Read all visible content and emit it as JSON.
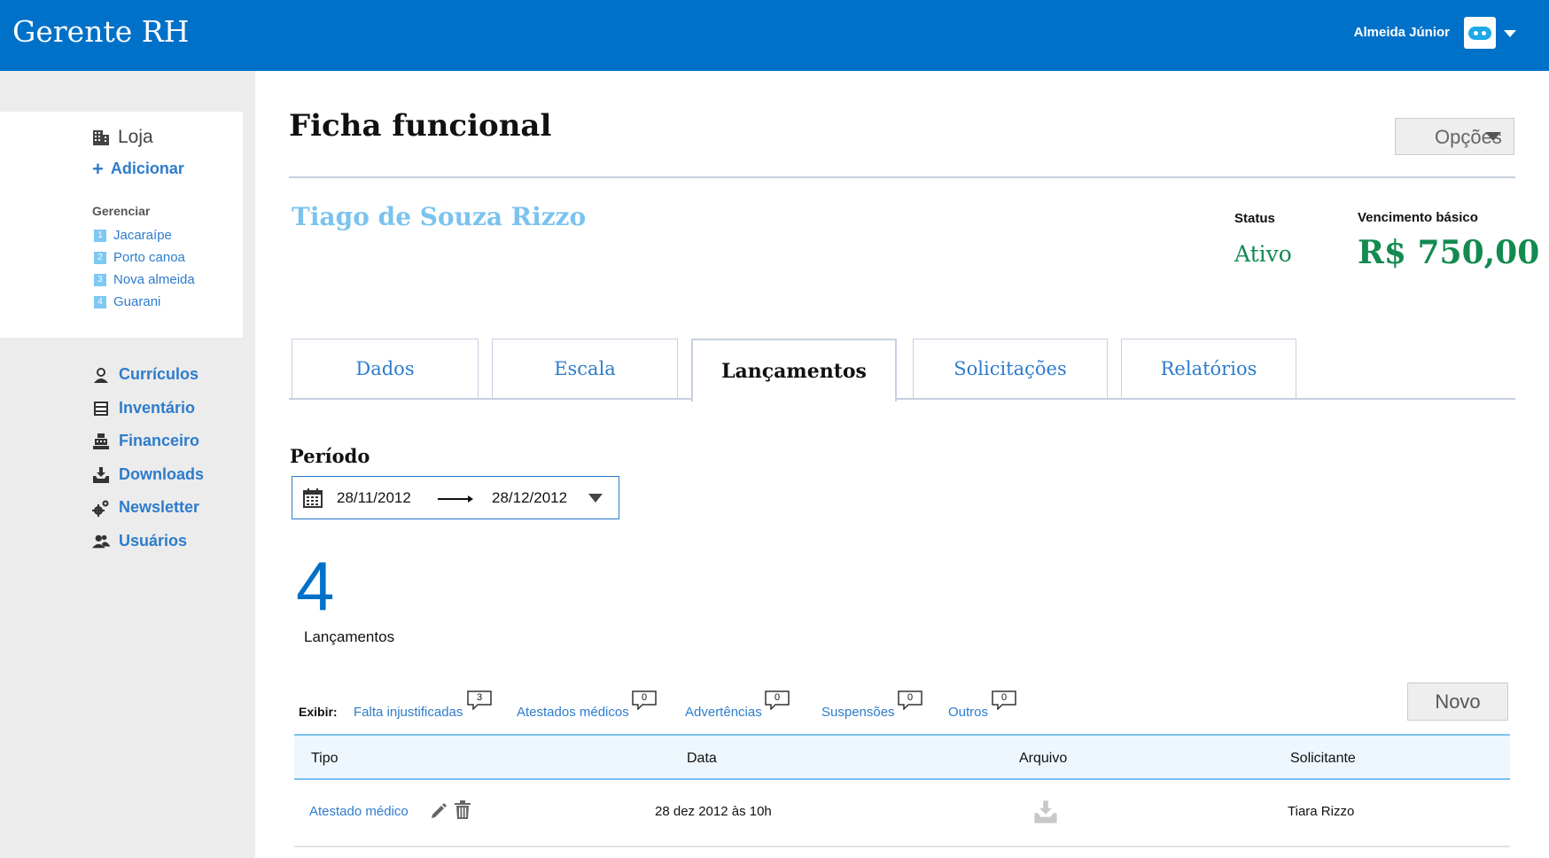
{
  "app": {
    "title": "Gerente RH"
  },
  "user": {
    "name": "Almeida Júnior"
  },
  "sidebar": {
    "store_title": "Loja",
    "add_label": "Adicionar",
    "manage_label": "Gerenciar",
    "stores": [
      {
        "num": "1",
        "label": "Jacaraípe"
      },
      {
        "num": "2",
        "label": "Porto canoa"
      },
      {
        "num": "3",
        "label": "Nova almeida"
      },
      {
        "num": "4",
        "label": "Guarani"
      }
    ],
    "nav": [
      {
        "label": "Currículos",
        "icon": "user-badge-icon"
      },
      {
        "label": "Inventário",
        "icon": "cabinet-icon"
      },
      {
        "label": "Financeiro",
        "icon": "cash-register-icon"
      },
      {
        "label": "Downloads",
        "icon": "download-tray-icon"
      },
      {
        "label": "Newsletter",
        "icon": "gears-icon"
      },
      {
        "label": "Usuários",
        "icon": "users-icon"
      }
    ]
  },
  "page": {
    "title": "Ficha funcional",
    "options_label": "Opções"
  },
  "employee": {
    "name": "Tiago de Souza Rizzo",
    "status_label": "Status",
    "status_value": "Ativo",
    "salary_label": "Vencimento básico",
    "salary_value": "R$ 750,00"
  },
  "tabs": [
    {
      "label": "Dados"
    },
    {
      "label": "Escala"
    },
    {
      "label": "Lançamentos",
      "active": true
    },
    {
      "label": "Solicitações"
    },
    {
      "label": "Relatórios"
    }
  ],
  "period": {
    "label": "Período",
    "start": "28/11/2012",
    "end": "28/12/2012"
  },
  "summary": {
    "count": "4",
    "label": "Lançamentos"
  },
  "filters": {
    "show_label": "Exibir:",
    "items": [
      {
        "label": "Falta injustificadas",
        "count": "3"
      },
      {
        "label": "Atestados médicos",
        "count": "0"
      },
      {
        "label": "Advertências",
        "count": "0"
      },
      {
        "label": "Suspensões",
        "count": "0"
      },
      {
        "label": "Outros",
        "count": "0"
      }
    ],
    "new_label": "Novo"
  },
  "table": {
    "headers": [
      "Tipo",
      "Data",
      "Arquivo",
      "Solicitante"
    ],
    "rows": [
      {
        "tipo": "Atestado médico",
        "data": "28 dez 2012 às 10h",
        "arquivo_icon": "download-tray-icon",
        "solicitante": "Tiara Rizzo"
      }
    ]
  },
  "colors": {
    "header_bg": "#0071c8",
    "link": "#2d7ccc",
    "name": "#7bc3ef",
    "status": "#128a50"
  }
}
